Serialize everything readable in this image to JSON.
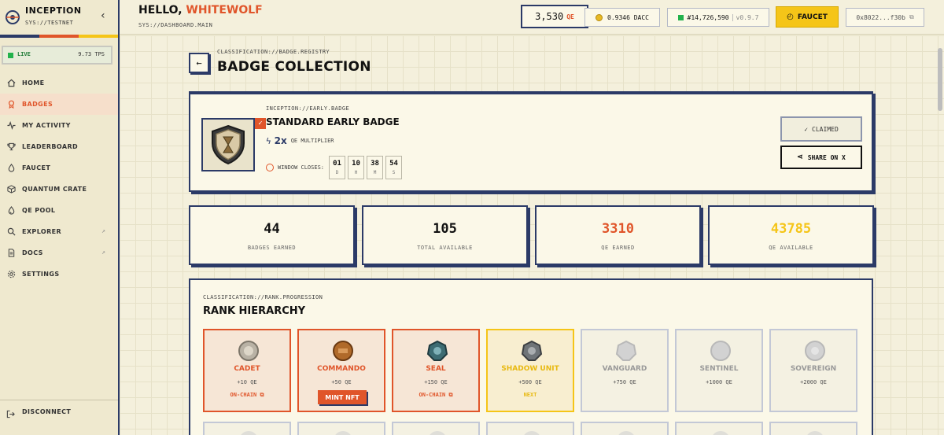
{
  "sidebar": {
    "brand_title": "INCEPTION",
    "brand_sub": "SYS://TESTNET",
    "live_label": "LIVE",
    "tps": "9.73 TPS",
    "items": [
      {
        "label": "HOME",
        "icon": "home-icon"
      },
      {
        "label": "BADGES",
        "icon": "badge-icon"
      },
      {
        "label": "MY ACTIVITY",
        "icon": "activity-icon"
      },
      {
        "label": "LEADERBOARD",
        "icon": "trophy-icon"
      },
      {
        "label": "FAUCET",
        "icon": "drop-icon"
      },
      {
        "label": "QUANTUM CRATE",
        "icon": "box-icon"
      },
      {
        "label": "QE POOL",
        "icon": "pool-icon"
      },
      {
        "label": "EXPLORER",
        "icon": "search-icon"
      },
      {
        "label": "DOCS",
        "icon": "doc-icon"
      },
      {
        "label": "SETTINGS",
        "icon": "gear-icon"
      }
    ],
    "disconnect": "DISCONNECT"
  },
  "header": {
    "hello": "HELLO,",
    "username": "WHITEWOLF",
    "sys_main": "SYS://DASHBOARD.MAIN",
    "qe_balance": "3,530",
    "qe_unit": "QE",
    "dacc": "0.9346 DACC",
    "block": "#14,726,590",
    "version": "v0.9.7",
    "faucet_label": "FAUCET",
    "wallet": "0x8022...f30b"
  },
  "page": {
    "crumb": "CLASSIFICATION://BADGE.REGISTRY",
    "title": "BADGE COLLECTION"
  },
  "badge": {
    "tag": "INCEPTION://EARLY.BADGE",
    "name": "STANDARD EARLY BADGE",
    "multiplier": "2x",
    "multiplier_label": "QE MULTIPLIER",
    "window_label": "WINDOW CLOSES:",
    "countdown": [
      {
        "n": "01",
        "u": "D"
      },
      {
        "n": "10",
        "u": "H"
      },
      {
        "n": "38",
        "u": "M"
      },
      {
        "n": "54",
        "u": "S"
      }
    ],
    "claimed_label": "CLAIMED",
    "share_label": "SHARE ON X"
  },
  "stats": [
    {
      "value": "44",
      "label": "BADGES EARNED",
      "color": "#111111"
    },
    {
      "value": "105",
      "label": "TOTAL AVAILABLE",
      "color": "#111111"
    },
    {
      "value": "3310",
      "label": "QE EARNED",
      "color": "#e0552a"
    },
    {
      "value": "43785",
      "label": "QE AVAILABLE",
      "color": "#f5c518"
    }
  ],
  "ranks": {
    "tag": "CLASSIFICATION://RANK.PROGRESSION",
    "title": "RANK HIERARCHY",
    "items": [
      {
        "name": "CADET",
        "qe": "+10 QE",
        "status": "ON-CHAIN",
        "state": "done",
        "medal": "#b9b2a5"
      },
      {
        "name": "COMMANDO",
        "qe": "+50 QE",
        "status": "MINT NFT",
        "state": "mint",
        "medal": "#b06a2a"
      },
      {
        "name": "SEAL",
        "qe": "+150 QE",
        "status": "ON-CHAIN",
        "state": "done",
        "medal": "#3d6c73"
      },
      {
        "name": "SHADOW UNIT",
        "qe": "+500 QE",
        "status": "NEXT",
        "state": "next",
        "medal": "#6f7478"
      },
      {
        "name": "VANGUARD",
        "qe": "+750 QE",
        "status": "",
        "state": "locked",
        "medal": "#c9c9c9"
      },
      {
        "name": "SENTINEL",
        "qe": "+1000 QE",
        "status": "",
        "state": "locked",
        "medal": "#c9c9c9"
      },
      {
        "name": "SOVEREIGN",
        "qe": "+2000 QE",
        "status": "",
        "state": "locked",
        "medal": "#c9c9c9"
      }
    ]
  },
  "colors": {
    "accent": "#e0552a",
    "navy": "#2b3a67",
    "yellow": "#f5c518",
    "green": "#22b24c"
  }
}
